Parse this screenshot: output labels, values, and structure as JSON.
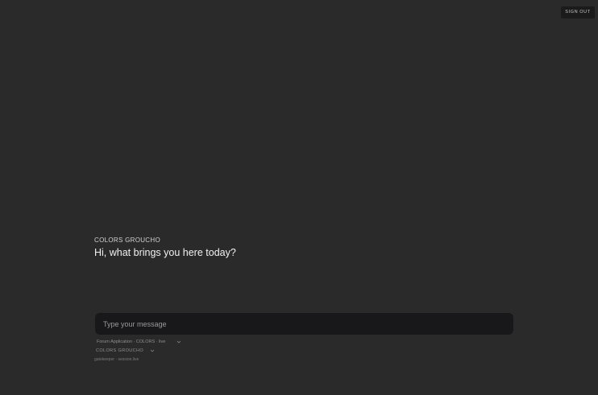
{
  "header": {
    "signout_label": "SIGN OUT"
  },
  "conversation": {
    "agent_name": "COLORS GROUCHO",
    "greeting": "Hi, what brings you here today?"
  },
  "composer": {
    "placeholder": "Type your message",
    "value": ""
  },
  "selectors": {
    "application": "Forum Application · COLORS · live",
    "agent": "COLORS GROUCHO"
  },
  "footer": {
    "text": "gatekeeper · session.live"
  },
  "icons": {
    "dropdown": "chevron-down-icon"
  },
  "colors": {
    "background": "#2a2a2a",
    "composer": "#18181a",
    "button": "#1b1b1c"
  }
}
